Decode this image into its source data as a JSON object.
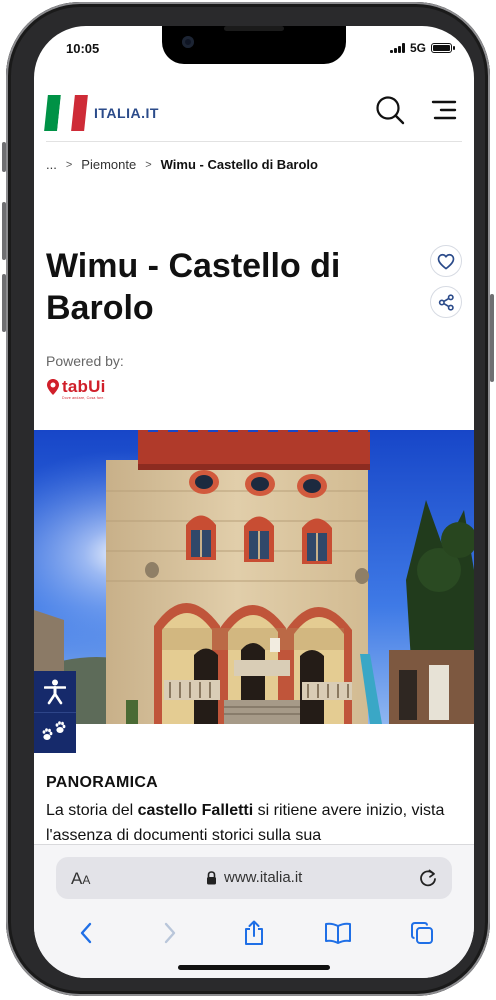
{
  "status_bar": {
    "time": "10:05",
    "network": "5G"
  },
  "header": {
    "logo_text": "ITALIA.IT",
    "search_icon": "search-icon",
    "menu_icon": "menu-icon"
  },
  "breadcrumb": {
    "ellipsis": "...",
    "items": [
      "Piemonte",
      "Wimu - Castello di Barolo"
    ]
  },
  "page": {
    "title": "Wimu - Castello di Barolo",
    "powered_by": "Powered by:",
    "partner_name": "tabUi",
    "partner_tagline": "Dove andare, Cosa fare."
  },
  "content": {
    "section_title": "PANORAMICA",
    "paragraph_start": "La storia del ",
    "paragraph_bold": "castello Falletti",
    "paragraph_rest": " si ritiene avere inizio, vista l'assenza di documenti storici sulla sua"
  },
  "browser": {
    "aa_label": "AA",
    "url": "www.italia.it"
  },
  "colors": {
    "brand_blue": "#2b4b8a",
    "accessibility_bg": "#162a6b",
    "partner_red": "#d01f2a",
    "flag_green": "#009246",
    "flag_red": "#ce2b37"
  },
  "icons": [
    "search-icon",
    "menu-icon",
    "heart-icon",
    "share-icon",
    "accessibility-icon",
    "paw-icon",
    "lock-icon",
    "reload-icon",
    "back-icon",
    "forward-icon",
    "share-sheet-icon",
    "bookmarks-icon",
    "tabs-icon"
  ]
}
